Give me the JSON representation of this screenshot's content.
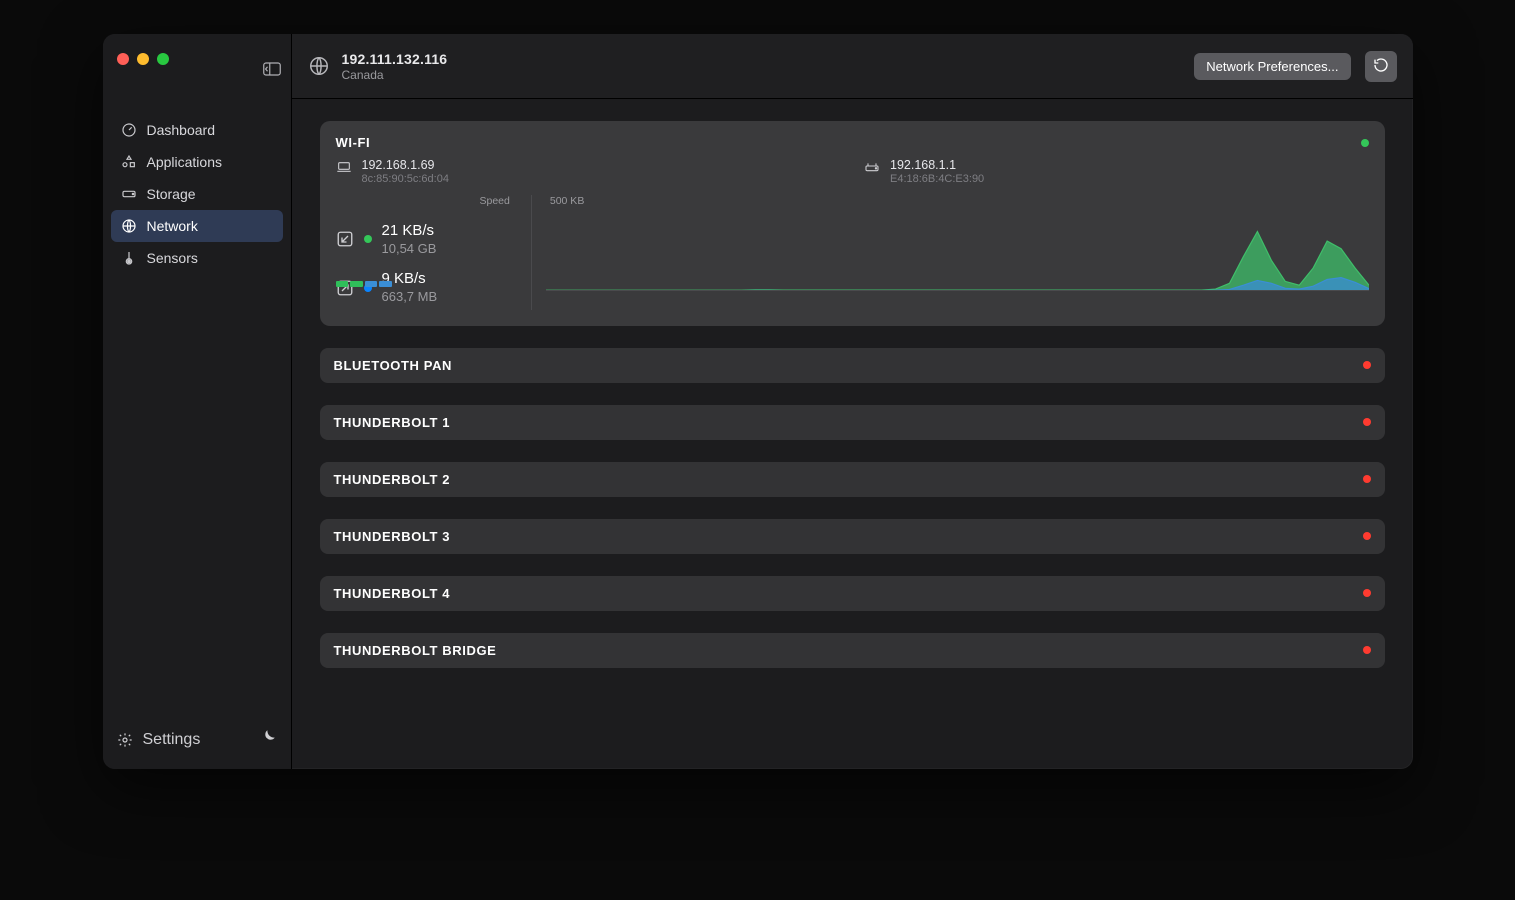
{
  "colors": {
    "accent_green": "#34c759",
    "accent_red": "#ff3b30",
    "chart_green": "#3fbf6a",
    "chart_blue": "#3a8ed6"
  },
  "sidebar": {
    "items": [
      {
        "icon": "gauge-icon",
        "label": "Dashboard"
      },
      {
        "icon": "apps-icon",
        "label": "Applications"
      },
      {
        "icon": "disk-icon",
        "label": "Storage"
      },
      {
        "icon": "globe-icon",
        "label": "Network"
      },
      {
        "icon": "thermo-icon",
        "label": "Sensors"
      }
    ],
    "active_index": 3,
    "settings_label": "Settings"
  },
  "toolbar": {
    "public_ip": "192.111.132.116",
    "location": "Canada",
    "prefs_button": "Network Preferences...",
    "refresh_label": "Refresh"
  },
  "wifi": {
    "title": "WI-FI",
    "status": "on",
    "device": {
      "ip": "192.168.1.69",
      "mac": "8c:85:90:5c:6d:04"
    },
    "router": {
      "ip": "192.168.1.1",
      "mac": "E4:18:6B:4C:E3:90"
    },
    "axis": {
      "speed_label": "Speed",
      "scale_label": "500 KB"
    },
    "down": {
      "rate": "21 KB/s",
      "total": "10,54 GB"
    },
    "up": {
      "rate": "9 KB/s",
      "total": "663,7 MB"
    }
  },
  "interfaces": [
    {
      "title": "BLUETOOTH PAN",
      "status": "off"
    },
    {
      "title": "THUNDERBOLT 1",
      "status": "off"
    },
    {
      "title": "THUNDERBOLT 2",
      "status": "off"
    },
    {
      "title": "THUNDERBOLT 3",
      "status": "off"
    },
    {
      "title": "THUNDERBOLT 4",
      "status": "off"
    },
    {
      "title": "THUNDERBOLT BRIDGE",
      "status": "off"
    }
  ],
  "chart_data": {
    "type": "area",
    "title": "",
    "xlabel": "",
    "ylabel": "Speed",
    "ylim": [
      0,
      500
    ],
    "y_unit": "KB",
    "x": [
      0,
      1,
      2,
      3,
      4,
      5,
      6,
      7,
      8,
      9,
      10,
      11,
      12,
      13,
      14,
      15,
      16,
      17,
      18,
      19,
      20,
      21,
      22,
      23,
      24,
      25,
      26,
      27,
      28,
      29,
      30,
      31,
      32,
      33,
      34,
      35,
      36,
      37,
      38,
      39,
      40,
      41,
      42,
      43,
      44,
      45,
      46,
      47,
      48,
      49,
      50,
      51,
      52,
      53,
      54,
      55,
      56,
      57,
      58,
      59
    ],
    "series": [
      {
        "name": "Download",
        "color": "#3fbf6a",
        "values": [
          4,
          4,
          4,
          4,
          4,
          4,
          4,
          4,
          4,
          4,
          4,
          4,
          4,
          4,
          4,
          6,
          6,
          5,
          5,
          5,
          5,
          5,
          5,
          5,
          5,
          5,
          5,
          5,
          5,
          5,
          5,
          5,
          5,
          5,
          5,
          5,
          5,
          5,
          5,
          5,
          5,
          5,
          5,
          5,
          5,
          5,
          5,
          5,
          10,
          40,
          180,
          310,
          160,
          50,
          30,
          120,
          260,
          220,
          120,
          30
        ]
      },
      {
        "name": "Upload",
        "color": "#3a8ed6",
        "values": [
          2,
          2,
          2,
          2,
          2,
          2,
          2,
          2,
          2,
          2,
          2,
          2,
          2,
          2,
          2,
          3,
          3,
          2,
          2,
          2,
          2,
          2,
          2,
          2,
          2,
          2,
          2,
          2,
          2,
          2,
          2,
          2,
          2,
          2,
          2,
          2,
          2,
          2,
          2,
          2,
          2,
          2,
          2,
          2,
          2,
          2,
          2,
          2,
          4,
          8,
          30,
          55,
          40,
          14,
          10,
          25,
          60,
          70,
          45,
          12
        ]
      }
    ]
  }
}
